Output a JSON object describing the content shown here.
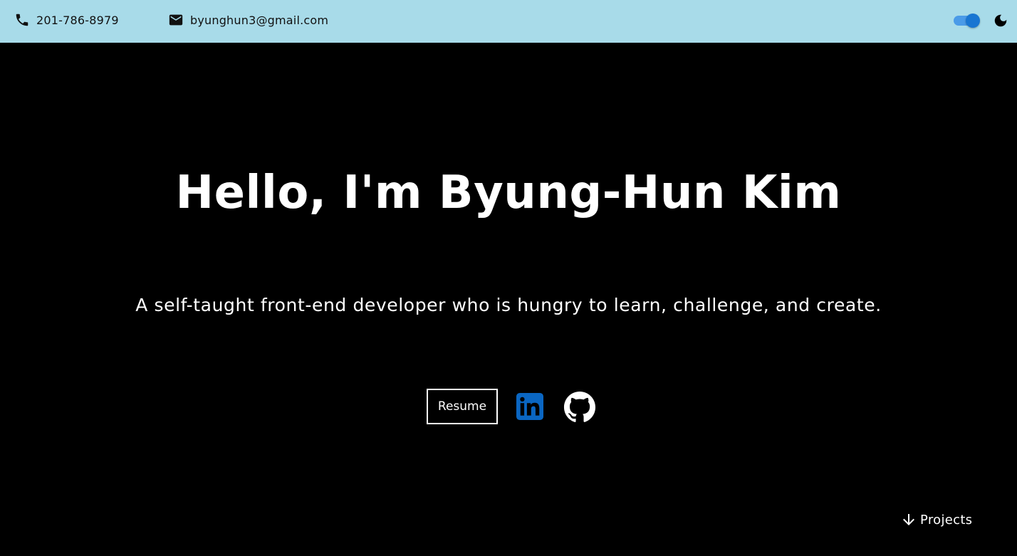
{
  "header": {
    "phone": "201-786-8979",
    "email": "byunghun3@gmail.com",
    "phone_icon": "phone-icon",
    "email_icon": "mail-icon",
    "theme_toggle_state": "on",
    "theme_icon": "moon-icon"
  },
  "hero": {
    "title": "Hello, I'm Byung-Hun Kim",
    "subtitle": "A self-taught front-end developer who is hungry to learn, challenge, and create."
  },
  "links": {
    "resume_label": "Resume",
    "linkedin_icon": "linkedin-icon",
    "github_icon": "github-icon"
  },
  "nav": {
    "projects_label": "Projects",
    "arrow_icon": "arrow-down-icon"
  },
  "colors": {
    "topbar_bg": "#a8dbe9",
    "page_bg": "#000000",
    "toggle_accent": "#1976d2",
    "linkedin_blue": "#0a66c2"
  }
}
